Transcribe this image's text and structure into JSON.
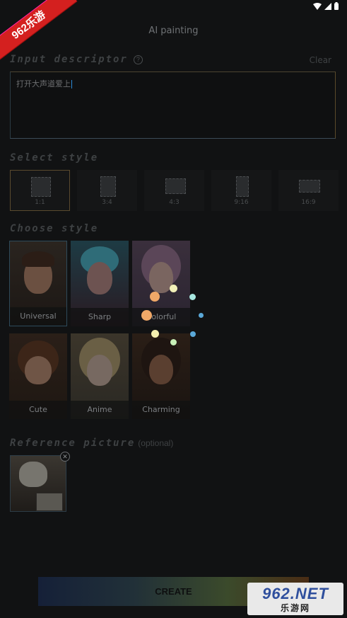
{
  "badge": {
    "text": "962乐游"
  },
  "header": {
    "title": "AI painting"
  },
  "input": {
    "label": "Input descriptor",
    "clear": "Clear",
    "value": "打开大声道爱上"
  },
  "select_style": {
    "label": "Select style",
    "ratios": [
      "1:1",
      "3:4",
      "4:3",
      "9:16",
      "16:9"
    ]
  },
  "choose_style": {
    "label": "Choose style",
    "styles": [
      "Universal",
      "Sharp",
      "Colorful",
      "Cute",
      "Anime",
      "Charming"
    ]
  },
  "reference": {
    "label": "Reference picture",
    "optional": "(optional)"
  },
  "create_button": "CREATE",
  "watermark": {
    "top_digits": "962",
    "top_suffix": ".NET",
    "bottom": "乐游网"
  }
}
